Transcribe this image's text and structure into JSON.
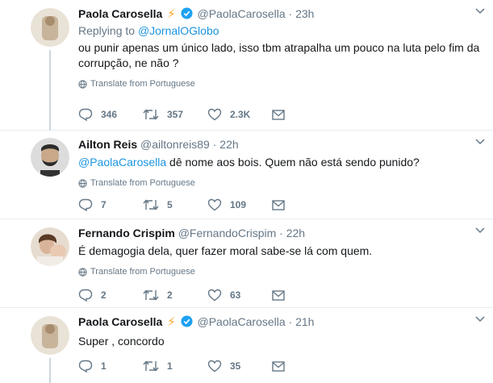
{
  "tweets": [
    {
      "name": "Paola Carosella",
      "handle": "@PaolaCarosella",
      "separator": "·",
      "time": "23h",
      "replying_prefix": "Replying to",
      "replying_to": "@JornalOGlobo",
      "text": "ou punir apenas um único lado, isso tbm atrapalha um pouco na luta pelo fim da corrupção, ne não ?",
      "translate": "Translate from Portuguese",
      "replies": "346",
      "retweets": "357",
      "likes": "2.3K"
    },
    {
      "name": "Ailton Reis",
      "handle": "@ailtonreis89",
      "separator": "·",
      "time": "22h",
      "mention": "@PaolaCarosella",
      "text": " dê nome aos bois. Quem não está sendo punido?",
      "translate": "Translate from Portuguese",
      "replies": "7",
      "retweets": "5",
      "likes": "109"
    },
    {
      "name": "Fernando Crispim",
      "handle": "@FernandoCrispim",
      "separator": "·",
      "time": "22h",
      "text": "É demagogia dela, quer fazer moral sabe-se lá com quem.",
      "translate": "Translate from Portuguese",
      "replies": "2",
      "retweets": "2",
      "likes": "63"
    },
    {
      "name": "Paola Carosella",
      "handle": "@PaolaCarosella",
      "separator": "·",
      "time": "21h",
      "text": "Super , concordo",
      "replies": "1",
      "retweets": "1",
      "likes": "35"
    }
  ],
  "colors": {
    "link": "#1b95e0",
    "muted": "#657786",
    "verified": "#1da1f2",
    "bolt": "#f5a623"
  }
}
